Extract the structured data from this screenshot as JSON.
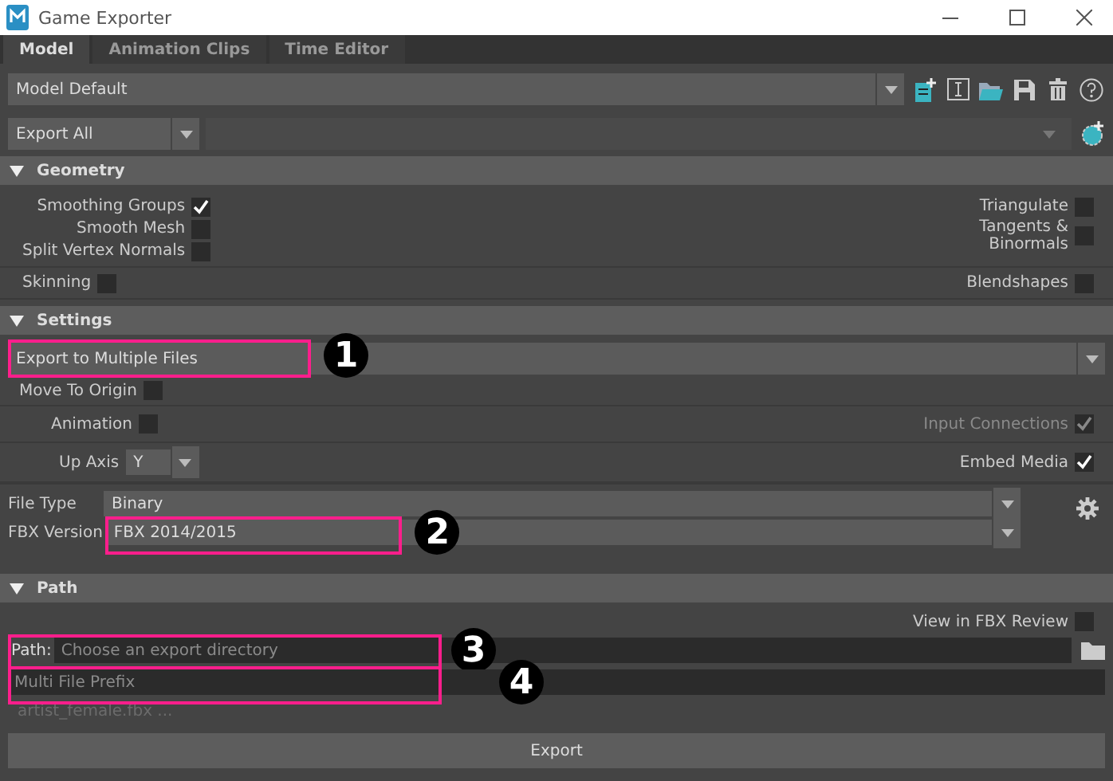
{
  "window": {
    "title": "Game Exporter"
  },
  "tabs": [
    {
      "label": "Model",
      "selected": true
    },
    {
      "label": "Animation Clips",
      "selected": false
    },
    {
      "label": "Time Editor",
      "selected": false
    }
  ],
  "preset": {
    "value": "Model Default"
  },
  "export_mode": {
    "value": "Export All"
  },
  "geometry": {
    "title": "Geometry",
    "expanded": true,
    "groups": [
      {
        "left": [
          {
            "label": "Smoothing Groups",
            "checked": true
          },
          {
            "label": "Smooth Mesh",
            "checked": false
          },
          {
            "label": "Split Vertex Normals",
            "checked": false
          }
        ],
        "right": [
          {
            "label": "Triangulate",
            "checked": false
          },
          {
            "label": "Tangents &\nBinormals",
            "checked": false
          }
        ]
      },
      {
        "left": [
          {
            "label": "Skinning",
            "checked": false
          }
        ],
        "right": [
          {
            "label": "Blendshapes",
            "checked": false
          }
        ]
      }
    ]
  },
  "settings": {
    "title": "Settings",
    "expanded": true,
    "export_type": {
      "value": "Export to Multiple Files",
      "callout": "1"
    },
    "move_to_origin": {
      "label": "Move To Origin",
      "checked": false
    },
    "animation": {
      "label": "Animation",
      "checked": false
    },
    "input_connections": {
      "label": "Input Connections",
      "checked": true,
      "disabled": true
    },
    "up_axis": {
      "label": "Up Axis",
      "value": "Y"
    },
    "embed_media": {
      "label": "Embed Media",
      "checked": true,
      "disabled": false
    },
    "file_type": {
      "label": "File Type",
      "value": "Binary"
    },
    "fbx_version": {
      "label": "FBX Version",
      "value": "FBX 2014/2015",
      "callout": "2"
    }
  },
  "path": {
    "title": "Path",
    "expanded": true,
    "view_in_fbx_review": {
      "label": "View in FBX Review",
      "checked": false
    },
    "directory": {
      "label": "Path:",
      "placeholder": "Choose an export directory",
      "callout": "3"
    },
    "prefix": {
      "placeholder": "Multi File Prefix",
      "callout": "4"
    },
    "preview": "artist_female.fbx ...",
    "export_button": "Export"
  }
}
